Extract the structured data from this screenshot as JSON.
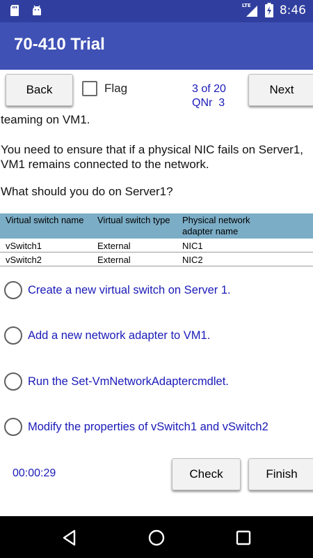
{
  "status_bar": {
    "time": "8:46",
    "left_icons": [
      "sd-card-icon",
      "android-icon"
    ],
    "right_icons": [
      "lte-signal-icon",
      "battery-charging-icon"
    ],
    "lte_label": "LTE"
  },
  "app_bar": {
    "title": "70-410 Trial"
  },
  "toolbar": {
    "back_label": "Back",
    "flag_label": "Flag",
    "flag_checked": false,
    "counter_line1": "3 of 20",
    "counter_line2": "QNr  3",
    "next_label": "Next"
  },
  "question": {
    "lines": [
      "teaming on VM1.",
      "You need to ensure that if a physical NIC fails on Server1,",
      "VM1 remains connected to the network.",
      "What should you do on Server1?"
    ]
  },
  "table": {
    "headers": [
      "Virtual switch name",
      "Virtual switch type",
      "Physical network",
      "adapter name"
    ],
    "rows": [
      [
        "vSwitch1",
        "External",
        "NIC1"
      ],
      [
        "vSwitch2",
        "External",
        "NIC2"
      ]
    ]
  },
  "options": [
    "Create a new virtual switch on Server 1.",
    "Add a new network adapter to VM1.",
    "Run the Set-VmNetworkAdaptercmdlet.",
    "Modify the properties of vSwitch1 and vSwitch2"
  ],
  "footer": {
    "timer": "00:00:29",
    "check_label": "Check",
    "finish_label": "Finish"
  },
  "colors": {
    "status_bar": "#303f9f",
    "app_bar": "#3f51b5",
    "accent_text": "#1a1ab8",
    "table_header": "#7badc6"
  }
}
